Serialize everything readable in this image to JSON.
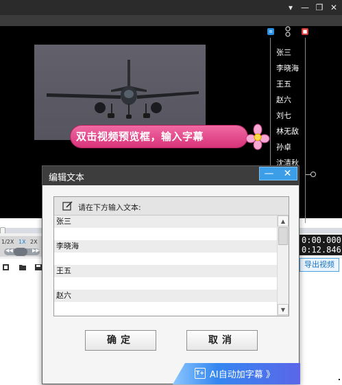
{
  "app": {
    "window_controls": [
      "▾",
      "—",
      "❐",
      "✕"
    ],
    "promo_text": "双击视频预览框，输入字幕",
    "speeds": [
      "1/2X",
      "1X",
      "2X"
    ],
    "active_speed": "1X",
    "time_current": "0:00.000",
    "time_total": "0:12.846",
    "export_label": "导出视频"
  },
  "subtitle_track": {
    "names": [
      "张三",
      "李晓海",
      "王五",
      "赵六",
      "刘七",
      "林无敌",
      "孙卓",
      "沈清秋"
    ]
  },
  "dialog": {
    "title": "编辑文本",
    "minimize": "—",
    "close": "✕",
    "prompt": "请在下方输入文本:",
    "lines": [
      "张三",
      "李晓海",
      "王五",
      "赵六"
    ],
    "confirm_label": "确定",
    "cancel_label": "取消",
    "ai_label": "AI自动加字幕 》",
    "ai_icon_text": "T+"
  },
  "colors": {
    "accent_blue": "#3c9ee6",
    "promo_pink": "#e0447f",
    "dark_bg": "#000000"
  }
}
